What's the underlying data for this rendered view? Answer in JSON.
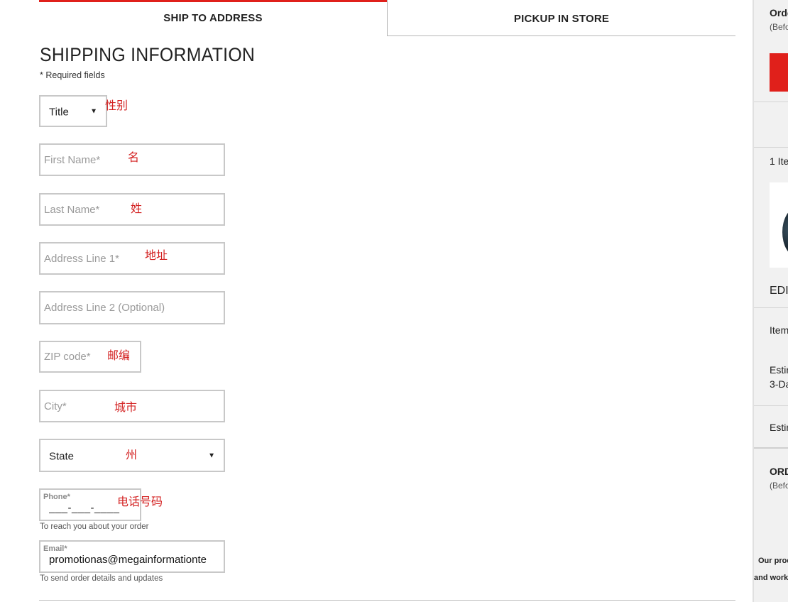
{
  "tabs": {
    "ship": "SHIP TO ADDRESS",
    "pickup": "PICKUP IN STORE"
  },
  "page": {
    "title": "SHIPPING INFORMATION",
    "required_note": "* Required fields"
  },
  "form": {
    "title_select": {
      "value": "Title"
    },
    "first_name": {
      "placeholder": "First Name*",
      "value": ""
    },
    "last_name": {
      "placeholder": "Last Name*",
      "value": ""
    },
    "address1": {
      "placeholder": "Address Line 1*",
      "value": ""
    },
    "address2": {
      "placeholder": "Address Line 2 (Optional)",
      "value": ""
    },
    "zip": {
      "placeholder": "ZIP code*",
      "value": ""
    },
    "city": {
      "placeholder": "City*",
      "value": ""
    },
    "state_select": {
      "value": "State"
    },
    "phone": {
      "label": "Phone*",
      "mask": "___-___-____",
      "helper": "To reach you about your order"
    },
    "email": {
      "label": "Email*",
      "value": "promotionas@megainformationte",
      "helper": "To send order details and updates"
    }
  },
  "annotations": {
    "title": "性别",
    "first_name": "名",
    "last_name": "姓",
    "address": "地址",
    "zip": "邮编",
    "city": "城市",
    "state": "州",
    "phone": "电话号码"
  },
  "summary": {
    "order_heading": "Orde",
    "before_1": "(Befo",
    "items_count": "1 Ite",
    "edit": "EDIT",
    "item_label": "Item",
    "estimate_1": "Estin",
    "shipping_method": "3-Da",
    "estimate_2": "Estin",
    "order_total": "ORD",
    "before_2": "(Befo",
    "note_1": "Our prod",
    "note_2": "and work"
  },
  "colors": {
    "accent": "#e0201b",
    "annotation": "#d32020",
    "border": "#c8c8c8"
  },
  "icons": {
    "caret": "▼"
  }
}
